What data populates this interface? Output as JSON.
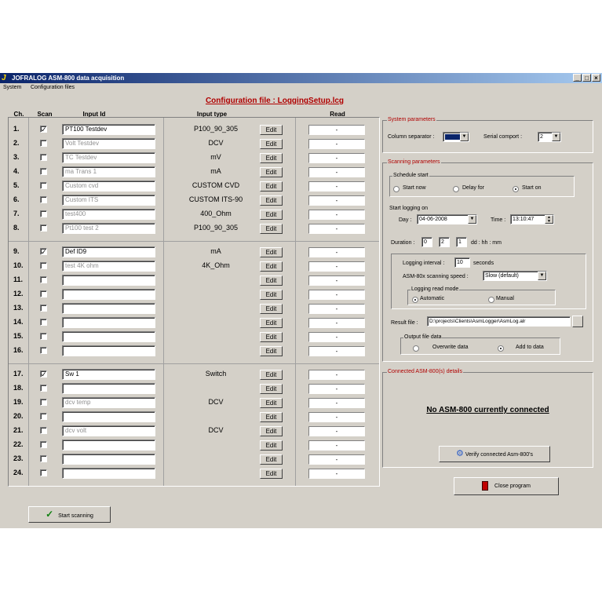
{
  "window": {
    "title": "JOFRALOG ASM-800 data acquisition",
    "buttons": [
      "_",
      "□",
      "×"
    ]
  },
  "menu": [
    "System",
    "Configuration files"
  ],
  "config_title": "Configuration file : LoggingSetup.lcg",
  "headers": {
    "ch": "Ch.",
    "scan": "Scan",
    "input_id": "Input Id",
    "input_type": "Input type",
    "read": "Read"
  },
  "edit_label": "Edit",
  "read_placeholder": "-",
  "channels": [
    {
      "ch": "1.",
      "checked": true,
      "id": "PT100 Testdev",
      "gray": false,
      "type": "P100_90_305"
    },
    {
      "ch": "2.",
      "checked": false,
      "id": "Volt Testdev",
      "gray": true,
      "type": "DCV"
    },
    {
      "ch": "3.",
      "checked": false,
      "id": "TC Testdev",
      "gray": true,
      "type": "mV"
    },
    {
      "ch": "4.",
      "checked": false,
      "id": "ma Trans 1",
      "gray": true,
      "type": "mA"
    },
    {
      "ch": "5.",
      "checked": false,
      "id": "Custom cvd",
      "gray": true,
      "type": "CUSTOM CVD"
    },
    {
      "ch": "6.",
      "checked": false,
      "id": "Custom ITS",
      "gray": true,
      "type": "CUSTOM ITS-90"
    },
    {
      "ch": "7.",
      "checked": false,
      "id": "test400",
      "gray": true,
      "type": "400_Ohm"
    },
    {
      "ch": "8.",
      "checked": false,
      "id": "Pt100 test 2",
      "gray": true,
      "type": "P100_90_305"
    },
    {
      "ch": "9.",
      "checked": true,
      "id": "Def ID9",
      "gray": false,
      "type": "mA"
    },
    {
      "ch": "10.",
      "checked": false,
      "id": "test 4K ohm",
      "gray": true,
      "type": "4K_Ohm"
    },
    {
      "ch": "11.",
      "checked": false,
      "id": "",
      "gray": false,
      "type": ""
    },
    {
      "ch": "12.",
      "checked": false,
      "id": "",
      "gray": false,
      "type": ""
    },
    {
      "ch": "13.",
      "checked": false,
      "id": "",
      "gray": false,
      "type": ""
    },
    {
      "ch": "14.",
      "checked": false,
      "id": "",
      "gray": false,
      "type": ""
    },
    {
      "ch": "15.",
      "checked": false,
      "id": "",
      "gray": false,
      "type": ""
    },
    {
      "ch": "16.",
      "checked": false,
      "id": "",
      "gray": false,
      "type": ""
    },
    {
      "ch": "17.",
      "checked": true,
      "id": "Sw 1",
      "gray": false,
      "type": "Switch"
    },
    {
      "ch": "18.",
      "checked": false,
      "id": "",
      "gray": false,
      "type": ""
    },
    {
      "ch": "19.",
      "checked": false,
      "id": "dcv temp",
      "gray": true,
      "type": "DCV"
    },
    {
      "ch": "20.",
      "checked": false,
      "id": "",
      "gray": false,
      "type": ""
    },
    {
      "ch": "21.",
      "checked": false,
      "id": "dcv volt",
      "gray": true,
      "type": "DCV"
    },
    {
      "ch": "22.",
      "checked": false,
      "id": "",
      "gray": false,
      "type": ""
    },
    {
      "ch": "23.",
      "checked": false,
      "id": "",
      "gray": false,
      "type": ""
    },
    {
      "ch": "24.",
      "checked": false,
      "id": "",
      "gray": false,
      "type": ""
    }
  ],
  "system_params": {
    "legend": "System parameters",
    "column_separator_label": "Column separator :",
    "serial_comport_label": "Serial comport :",
    "serial_comport_value": "2"
  },
  "scanning": {
    "legend": "Scanning parameters",
    "schedule_legend": "Schedule start",
    "schedule_options": [
      "Start now",
      "Delay for",
      "Start on"
    ],
    "schedule_selected": 2,
    "start_logging_label": "Start logging on",
    "day_label": "Day :",
    "day_value": "04-06-2008",
    "time_label": "Time :",
    "time_value": "13:10:47",
    "duration_label": "Duration :",
    "duration_values": [
      "0",
      "2",
      "1"
    ],
    "duration_unit": "dd : hh : mm",
    "interval_label": "Logging interval :",
    "interval_value": "10",
    "interval_unit": "seconds",
    "speed_label": "ASM-80x scanning speed :",
    "speed_value": "Slow (default)",
    "read_mode_legend": "Logging read mode",
    "read_mode_options": [
      "Automatic",
      "Manual"
    ],
    "read_mode_selected": 0,
    "result_label": "Result file :",
    "result_value": "D:\\projects\\Clients\\AsmLogger\\AsmLog.alr",
    "output_legend": "Output file data",
    "output_options": [
      "Overwrite data",
      "Add to data"
    ],
    "output_selected": 1
  },
  "connected": {
    "legend": "Connected ASM-800(s) details",
    "status": "No ASM-800 currently connected",
    "verify_button": "Verify connected Asm-800's"
  },
  "close_button": "Close program",
  "start_button": "Start scanning",
  "colors": {
    "window_bg": "#d4d0c8",
    "title_blue": "#0a246a",
    "red_text": "#b00000",
    "separator_swatch": "#0a246a"
  }
}
